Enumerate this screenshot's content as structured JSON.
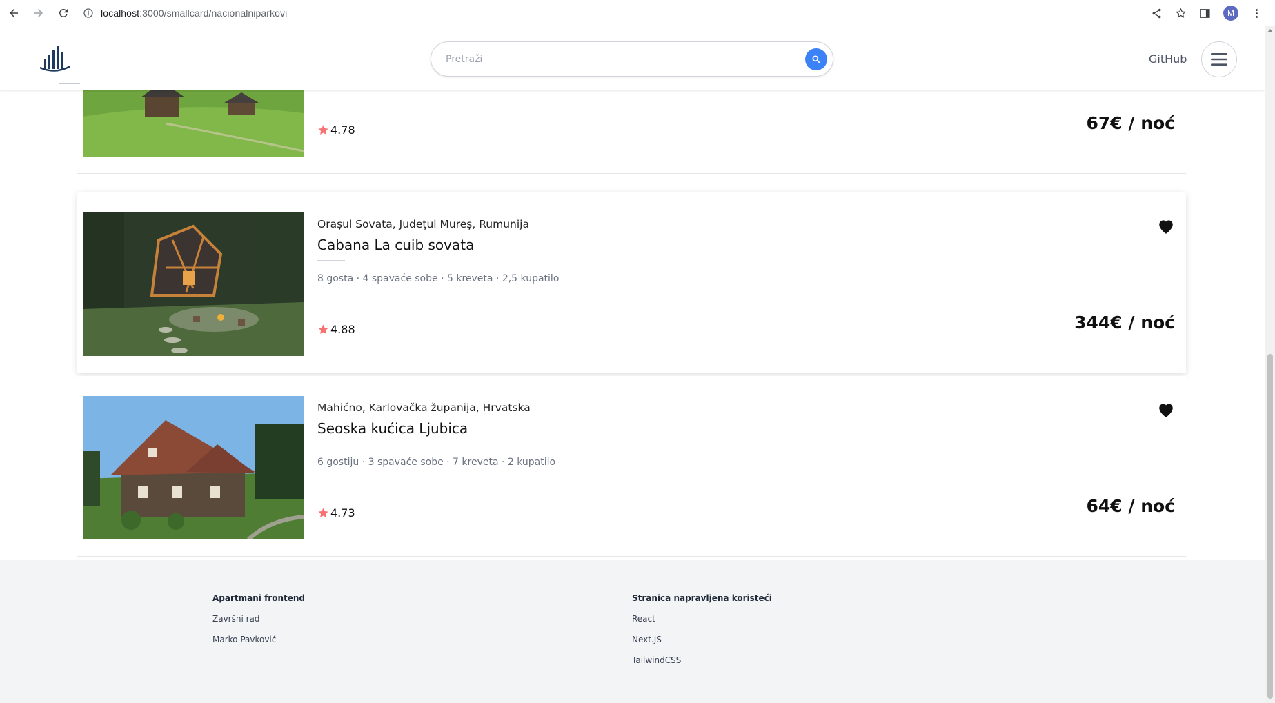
{
  "browser": {
    "url_host": "localhost",
    "url_path": ":3000/smallcard/nacionalniparkovi",
    "profile_initial": "M"
  },
  "header": {
    "search_placeholder": "Pretraži",
    "github_label": "GitHub"
  },
  "listings": [
    {
      "location": "",
      "title": "",
      "details": "",
      "rating": "4.78",
      "price": "67€ / noć"
    },
    {
      "location": "Orașul Sovata, Județul Mureș, Rumunija",
      "title": "Cabana La cuib sovata",
      "details": "8 gosta · 4 spavaće sobe · 5 kreveta · 2,5 kupatilo",
      "rating": "4.88",
      "price": "344€ / noć"
    },
    {
      "location": "Mahićno, Karlovačka županija, Hrvatska",
      "title": "Seoska kućica Ljubica",
      "details": "6 gostiju · 3 spavaće sobe · 7 kreveta · 2 kupatilo",
      "rating": "4.73",
      "price": "64€ / noć"
    }
  ],
  "footer": {
    "col1": {
      "heading": "Apartmani frontend",
      "links": [
        "Završni rad",
        "Marko Pavković"
      ]
    },
    "col2": {
      "heading": "Stranica napravljena koristeći",
      "links": [
        "React",
        "Next.JS",
        "TailwindCSS"
      ]
    }
  },
  "colors": {
    "accent": "#3b82f6",
    "star": "#f87171",
    "footer_bg": "#f3f4f6"
  }
}
